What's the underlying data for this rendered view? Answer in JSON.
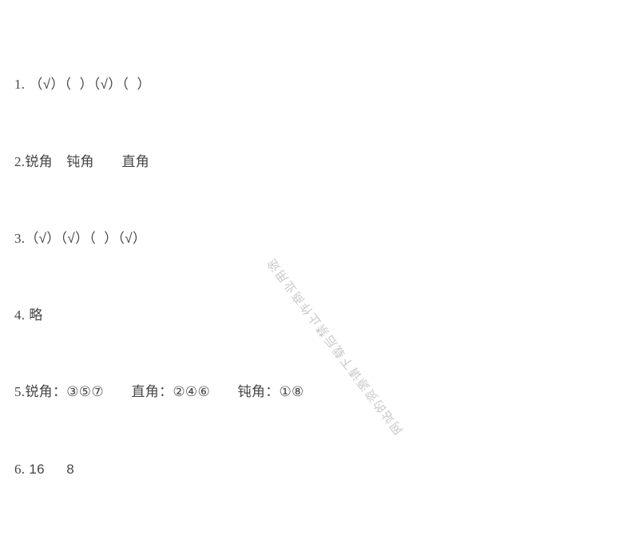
{
  "document": {
    "type": "answer-key",
    "background_color": "#ffffff",
    "text_color": "#454545"
  },
  "answers": [
    {
      "number": "1.",
      "text": "（√）（  ）（√）（  ）"
    },
    {
      "number": "2.",
      "text": "锐角　钝角　　直角"
    },
    {
      "number": "3.",
      "text": "（√）（√）（  ）（√）"
    },
    {
      "number": "4.",
      "text": "略"
    },
    {
      "number": "5.",
      "text": "锐角：③⑤⑦　　直角：②④⑥　　钝角：①⑧"
    },
    {
      "number": "6.",
      "text": "16　  8"
    }
  ],
  "watermark": {
    "text": "网站的资源请下载后禁止作商业用途",
    "color": "#c9c9c9",
    "rotation_degrees": 233
  }
}
